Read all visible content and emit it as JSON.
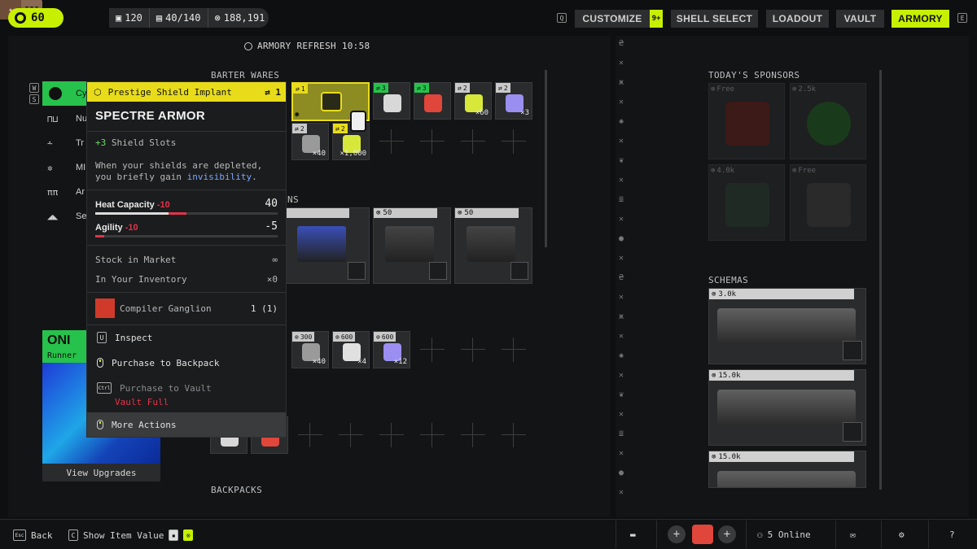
{
  "top": {
    "level": "60",
    "emblem": "III",
    "stats": [
      "120",
      "40/140",
      "188,191"
    ],
    "key_left": "Q",
    "key_right": "E",
    "nav": [
      {
        "label": "CUSTOMIZE",
        "badge": "9+"
      },
      {
        "label": "SHELL SELECT"
      },
      {
        "label": "LOADOUT"
      },
      {
        "label": "VAULT"
      },
      {
        "label": "ARMORY",
        "active": true
      }
    ]
  },
  "refresh": "ARMORY REFRESH 10:58",
  "sections": {
    "barter": "BARTER WARES",
    "weapons_partial": "ONS",
    "backpacks_partial": "BACKPACKS"
  },
  "left_list": {
    "keys": [
      "W",
      "S"
    ],
    "items": [
      "Cy",
      "Nu",
      "Tr",
      "MI",
      "Ar",
      "Se"
    ]
  },
  "barter_tiles": [
    {
      "count": "1",
      "qty": ""
    },
    {
      "count": "3",
      "qty": ""
    },
    {
      "count": "3",
      "qty": ""
    },
    {
      "count": "2",
      "qty": "×60"
    },
    {
      "count": "2",
      "qty": "×3"
    },
    {
      "count": "2",
      "qty": "×40"
    },
    {
      "count": "2",
      "qty": "×1,000"
    }
  ],
  "weapon_cards": [
    {
      "price": ""
    },
    {
      "price": "50"
    },
    {
      "price": "50"
    }
  ],
  "ammo_tiles": [
    {
      "price": "300",
      "qty": "×40"
    },
    {
      "price": "600",
      "qty": "×4"
    },
    {
      "price": "600",
      "qty": "×12"
    }
  ],
  "popup": {
    "header": "Prestige Shield Implant",
    "header_count": "1",
    "title": "SPECTRE ARMOR",
    "bonus_value": "+3",
    "bonus_label": "Shield Slots",
    "desc_1": "When your shields are depleted,",
    "desc_2a": "you briefly gain ",
    "desc_2b": "invisibility",
    "desc_2c": ".",
    "stat1_label": "Heat Capacity",
    "stat1_delta": "-10",
    "stat1_value": "40",
    "stat1_fraction": 0.5,
    "stat2_label": "Agility",
    "stat2_delta": "-10",
    "stat2_value": "-5",
    "stat2_fraction": 0.05,
    "stock_label": "Stock in Market",
    "stock_value": "∞",
    "inv_label": "In Your Inventory",
    "inv_value": "×0",
    "cost_label": "Compiler Ganglion",
    "cost_value": "1 (1)",
    "actions": {
      "inspect_key": "U",
      "inspect": "Inspect",
      "purchase_backpack": "Purchase to Backpack",
      "purchase_vault": "Purchase to Vault",
      "vault_full": "Vault Full",
      "more": "More Actions",
      "ctrl_key": "Ctrl"
    }
  },
  "oni": {
    "name": "ONI",
    "role": "Runner",
    "button": "View Upgrades"
  },
  "sponsors": {
    "title": "TODAY'S SPONSORS",
    "items": [
      {
        "price": "Free"
      },
      {
        "price": "2.5k"
      },
      {
        "price": "4.0k"
      },
      {
        "price": "Free"
      }
    ]
  },
  "schemas": {
    "title": "SCHEMAS",
    "items": [
      {
        "price": "3.0k"
      },
      {
        "price": "15.0k"
      },
      {
        "price": "15.0k"
      }
    ]
  },
  "bottom": {
    "back_key": "Esc",
    "back": "Back",
    "show_key": "C",
    "show": "Show Item Value",
    "online": "5 Online",
    "help": "?"
  },
  "colors": {
    "accent": "#c7f000",
    "warning_yellow": "#e8dc1a",
    "negative": "#e2334a",
    "positive": "#6fd86f",
    "oni_green": "#27c24c"
  }
}
